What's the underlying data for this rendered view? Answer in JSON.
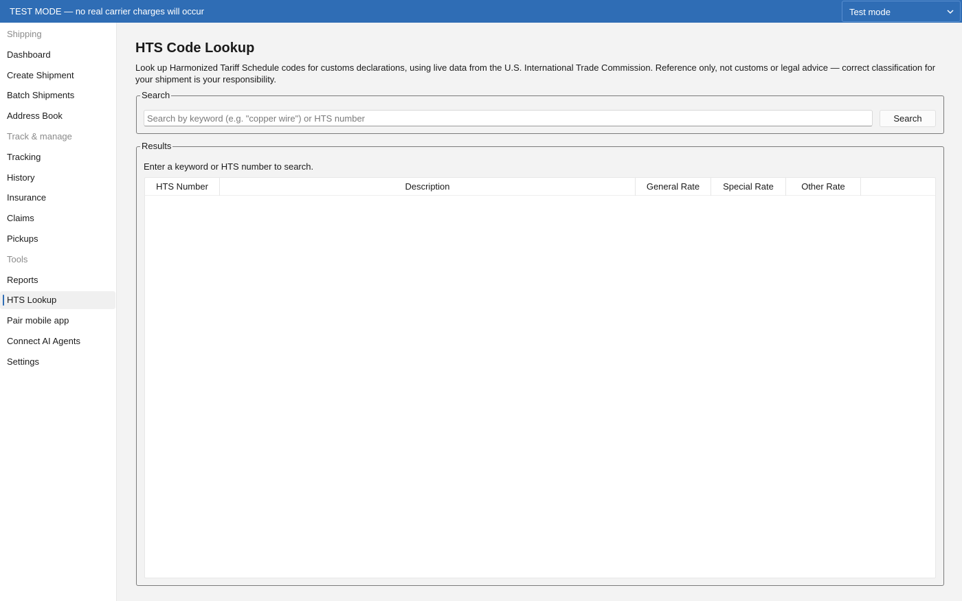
{
  "banner": {
    "text": "TEST MODE — no real carrier charges will occur",
    "color": "#2f6db5"
  },
  "mode_select": {
    "value": "Test mode",
    "icon": "chevron-down-icon"
  },
  "sidebar": {
    "rows": [
      {
        "kind": "section",
        "label": "Shipping"
      },
      {
        "kind": "item",
        "label": "Dashboard"
      },
      {
        "kind": "item",
        "label": "Create Shipment"
      },
      {
        "kind": "item",
        "label": "Batch Shipments"
      },
      {
        "kind": "item",
        "label": "Address Book"
      },
      {
        "kind": "section",
        "label": "Track & manage"
      },
      {
        "kind": "item",
        "label": "Tracking"
      },
      {
        "kind": "item",
        "label": "History"
      },
      {
        "kind": "item",
        "label": "Insurance"
      },
      {
        "kind": "item",
        "label": "Claims"
      },
      {
        "kind": "item",
        "label": "Pickups"
      },
      {
        "kind": "section",
        "label": "Tools"
      },
      {
        "kind": "item",
        "label": "Reports"
      },
      {
        "kind": "item",
        "label": "HTS Lookup",
        "active": true
      },
      {
        "kind": "item",
        "label": "Pair mobile app"
      },
      {
        "kind": "item",
        "label": "Connect AI Agents"
      },
      {
        "kind": "item",
        "label": "Settings"
      }
    ]
  },
  "page": {
    "title": "HTS Code Lookup",
    "description": "Look up Harmonized Tariff Schedule codes for customs declarations, using live data from the U.S. International Trade Commission. Reference only, not customs or legal advice — correct classification for your shipment is your responsibility."
  },
  "search": {
    "legend": "Search",
    "placeholder": "Search by keyword (e.g. \"copper wire\") or HTS number",
    "value": "",
    "button_label": "Search"
  },
  "results": {
    "legend": "Results",
    "status": "Enter a keyword or HTS number to search.",
    "columns": [
      "HTS Number",
      "Description",
      "General Rate",
      "Special Rate",
      "Other Rate"
    ],
    "rows": []
  }
}
